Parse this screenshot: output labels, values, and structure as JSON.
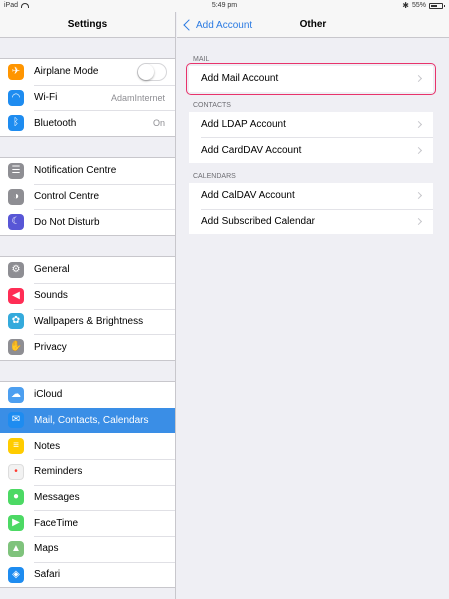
{
  "status_bar": {
    "device": "iPad",
    "time": "5:49 pm",
    "battery": "55%",
    "battery_level": 0.55
  },
  "settings": {
    "title": "Settings",
    "groups": [
      [
        {
          "label": "Airplane Mode",
          "icon": "airplane-icon",
          "color": "#ff9500",
          "toggle": false
        },
        {
          "label": "Wi-Fi",
          "icon": "wifi-icon",
          "color": "#1e8cf0",
          "value": "AdamInternet"
        },
        {
          "label": "Bluetooth",
          "icon": "bluetooth-icon",
          "color": "#1e8cf0",
          "value": "On"
        }
      ],
      [
        {
          "label": "Notification Centre",
          "icon": "notification-centre-icon",
          "color": "#8e8e93"
        },
        {
          "label": "Control Centre",
          "icon": "control-centre-icon",
          "color": "#8e8e93"
        },
        {
          "label": "Do Not Disturb",
          "icon": "moon-icon",
          "color": "#5856d6"
        }
      ],
      [
        {
          "label": "General",
          "icon": "gear-icon",
          "color": "#8e8e93"
        },
        {
          "label": "Sounds",
          "icon": "speaker-icon",
          "color": "#ff2d55"
        },
        {
          "label": "Wallpapers & Brightness",
          "icon": "wallpaper-icon",
          "color": "#34aadc"
        },
        {
          "label": "Privacy",
          "icon": "hand-icon",
          "color": "#8e8e93"
        }
      ],
      [
        {
          "label": "iCloud",
          "icon": "icloud-icon",
          "color": "#4d9ff0"
        },
        {
          "label": "Mail, Contacts, Calendars",
          "icon": "mail-icon",
          "color": "#1e8cf0",
          "selected": true
        },
        {
          "label": "Notes",
          "icon": "notes-icon",
          "color": "#ffcc00"
        },
        {
          "label": "Reminders",
          "icon": "reminders-icon",
          "color": "#f2f2f2"
        },
        {
          "label": "Messages",
          "icon": "messages-icon",
          "color": "#4cd964"
        },
        {
          "label": "FaceTime",
          "icon": "facetime-icon",
          "color": "#4cd964"
        },
        {
          "label": "Maps",
          "icon": "maps-icon",
          "color": "#7fc37c"
        },
        {
          "label": "Safari",
          "icon": "safari-icon",
          "color": "#1e8cf0"
        }
      ]
    ]
  },
  "detail": {
    "back_label": "Add Account",
    "title": "Other",
    "sections": [
      {
        "header": "MAIL",
        "items": [
          {
            "label": "Add Mail Account",
            "highlighted": true
          }
        ]
      },
      {
        "header": "CONTACTS",
        "items": [
          {
            "label": "Add LDAP Account"
          },
          {
            "label": "Add CardDAV Account"
          }
        ]
      },
      {
        "header": "CALENDARS",
        "items": [
          {
            "label": "Add CalDAV Account"
          },
          {
            "label": "Add Subscribed Calendar"
          }
        ]
      }
    ]
  }
}
